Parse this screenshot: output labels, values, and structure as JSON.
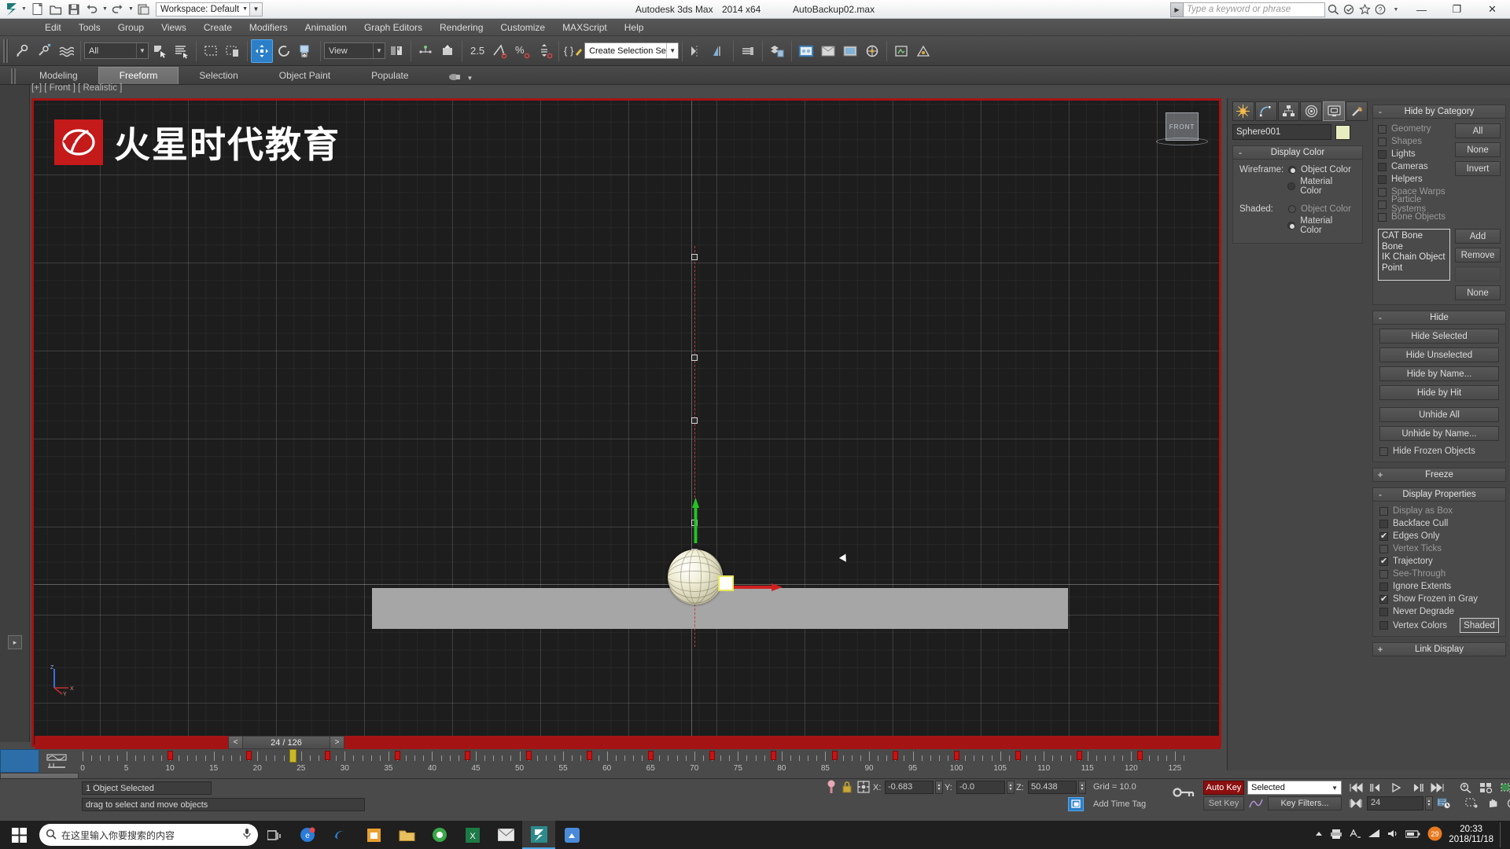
{
  "titlebar": {
    "workspace_label": "Workspace: Default",
    "app_title": "Autodesk 3ds Max",
    "version": "2014 x64",
    "filename": "AutoBackup02.max",
    "search_placeholder": "Type a keyword or phrase",
    "minimize": "—",
    "maximize": "❐",
    "close": "✕"
  },
  "menubar": {
    "items": [
      "Edit",
      "Tools",
      "Group",
      "Views",
      "Create",
      "Modifiers",
      "Animation",
      "Graph Editors",
      "Rendering",
      "Customize",
      "MAXScript",
      "Help"
    ]
  },
  "toolbar": {
    "filter_combo": "All",
    "ref_coord_combo": "View",
    "angle_snap_value": "2.5",
    "selection_set_combo": "Create Selection Set"
  },
  "ribbon": {
    "tabs": [
      {
        "label": "Modeling",
        "active": false
      },
      {
        "label": "Freeform",
        "active": true
      },
      {
        "label": "Selection",
        "active": false
      },
      {
        "label": "Object Paint",
        "active": false
      },
      {
        "label": "Populate",
        "active": false
      }
    ]
  },
  "viewport": {
    "label": "[+] [ Front ] [ Realistic ]",
    "watermark_text": "火星时代教育",
    "viewcube_face": "FRONT",
    "axis_x": "X",
    "axis_y": "Y",
    "axis_z": "Z"
  },
  "command_panel": {
    "tabs": [
      "create-tab",
      "modify-tab",
      "hierarchy-tab",
      "motion-tab",
      "display-tab",
      "utilities-tab"
    ],
    "active_tab_index": 4,
    "object_name": "Sphere001",
    "object_color": "#e8ecc0",
    "display_color": {
      "title": "Display Color",
      "collapse": "-",
      "wireframe_label": "Wireframe:",
      "shaded_label": "Shaded:",
      "wireframe_options": [
        {
          "label": "Object Color",
          "selected": true
        },
        {
          "label": "Material Color",
          "selected": false
        }
      ],
      "shaded_options": [
        {
          "label": "Object Color",
          "selected": false
        },
        {
          "label": "Material Color",
          "selected": true
        }
      ]
    },
    "hide_by_category": {
      "title": "Hide by Category",
      "collapse": "-",
      "categories": [
        {
          "label": "Geometry",
          "checked": false,
          "dim": true
        },
        {
          "label": "Shapes",
          "checked": false,
          "dim": true
        },
        {
          "label": "Lights",
          "checked": false,
          "dim": false
        },
        {
          "label": "Cameras",
          "checked": false,
          "dim": false
        },
        {
          "label": "Helpers",
          "checked": false,
          "dim": false
        },
        {
          "label": "Space Warps",
          "checked": false,
          "dim": true
        },
        {
          "label": "Particle Systems",
          "checked": false,
          "dim": true
        },
        {
          "label": "Bone Objects",
          "checked": false,
          "dim": true
        }
      ],
      "buttons": [
        "All",
        "None",
        "Invert"
      ],
      "list_items": [
        "CAT Bone",
        "Bone",
        "IK Chain Object",
        "Point"
      ],
      "list_buttons": [
        "Add",
        "Remove",
        "",
        "None"
      ]
    },
    "hide": {
      "title": "Hide",
      "collapse": "-",
      "buttons": [
        "Hide Selected",
        "Hide Unselected",
        "Hide by Name...",
        "Hide by Hit",
        "Unhide All",
        "Unhide by Name..."
      ],
      "checkbox": {
        "label": "Hide Frozen Objects",
        "checked": false
      }
    },
    "freeze": {
      "title": "Freeze",
      "collapse": "+"
    },
    "display_properties": {
      "title": "Display Properties",
      "collapse": "-",
      "items": [
        {
          "label": "Display as Box",
          "checked": false,
          "dim": true
        },
        {
          "label": "Backface Cull",
          "checked": false,
          "dim": false
        },
        {
          "label": "Edges Only",
          "checked": true,
          "dim": false
        },
        {
          "label": "Vertex Ticks",
          "checked": false,
          "dim": true
        },
        {
          "label": "Trajectory",
          "checked": true,
          "dim": false
        },
        {
          "label": "See-Through",
          "checked": false,
          "dim": true
        },
        {
          "label": "Ignore Extents",
          "checked": false,
          "dim": false
        },
        {
          "label": "Show Frozen in Gray",
          "checked": true,
          "dim": false
        },
        {
          "label": "Never Degrade",
          "checked": false,
          "dim": false
        },
        {
          "label": "Vertex Colors",
          "checked": false,
          "dim": false
        }
      ],
      "shaded_button": "Shaded"
    },
    "link_display": {
      "title": "Link Display",
      "collapse": "+"
    }
  },
  "timeline": {
    "current_frame_display": "24 / 126",
    "prev_arrow": "<",
    "next_arrow": ">",
    "ruler_labels": [
      "0",
      "5",
      "10",
      "15",
      "20",
      "25",
      "30",
      "35",
      "40",
      "45",
      "50",
      "55",
      "60",
      "65",
      "70",
      "75",
      "80",
      "85",
      "90",
      "95",
      "100",
      "105",
      "110",
      "115",
      "120",
      "125"
    ],
    "key_frames": [
      10,
      19,
      24,
      28,
      36,
      44,
      51,
      58,
      65,
      72,
      79,
      86,
      93,
      100,
      107,
      114,
      121
    ],
    "current_frame": 24
  },
  "statusbar": {
    "selection_text": "1 Object Selected",
    "prompt_text": "drag to select and move objects",
    "coords": {
      "x_label": "X:",
      "x_value": "-0.683",
      "y_label": "Y:",
      "y_value": "-0.0",
      "z_label": "Z:",
      "z_value": "50.438"
    },
    "grid_text": "Grid = 10.0",
    "add_time_tag": "Add Time Tag",
    "auto_key": "Auto Key",
    "set_key": "Set Key",
    "selected_combo": "Selected",
    "key_filters": "Key Filters...",
    "frame_field": "24"
  },
  "taskbar": {
    "search_placeholder": "在这里输入你要搜索的内容",
    "clock_time": "20:33",
    "clock_date": "2018/11/18",
    "tray_count": "29"
  },
  "colors": {
    "accent_blue": "#2b7fc9",
    "viewport_border_red": "#a41414",
    "autokey_red": "#8c0f0f",
    "logo_red": "#c41a1a",
    "object_swatch": "#e8ecc0"
  }
}
